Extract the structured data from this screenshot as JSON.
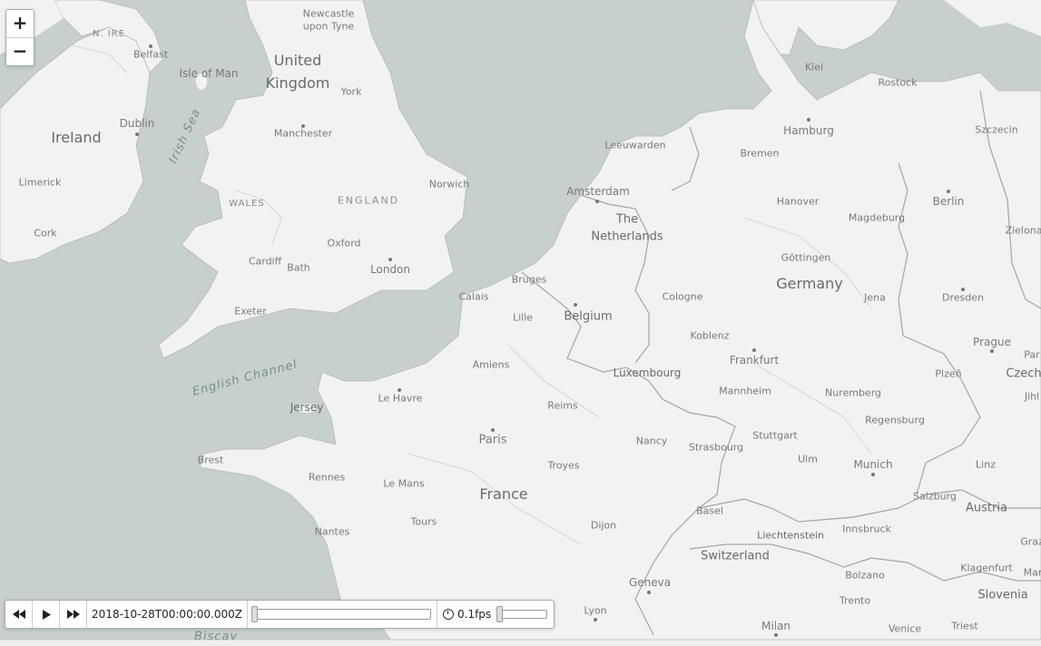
{
  "map": {
    "colors": {
      "water": "#c7cfcf",
      "land": "#f2f2f2",
      "border": "#a9a9a9"
    },
    "labels": {
      "countries": [
        "United",
        "Kingdom",
        "Ireland",
        "France",
        "Germany",
        "Belgium",
        "The",
        "Netherlands",
        "Luxembourg",
        "Switzerland",
        "Liechtenstein",
        "Austria",
        "Slovenia",
        "Czech",
        "Jersey"
      ],
      "regions": [
        "N. IRE",
        "ENGLAND",
        "WALES"
      ],
      "water": [
        "Irish Sea",
        "English Channel",
        "Biscay"
      ],
      "cities": [
        "Newcastle",
        "upon Tyne",
        "Belfast",
        "Isle of Man",
        "York",
        "Dublin",
        "Manchester",
        "Limerick",
        "Cork",
        "Norwich",
        "Oxford",
        "London",
        "Cardiff",
        "Bath",
        "Exeter",
        "Calais",
        "Bruges",
        "Lille",
        "Amiens",
        "Le Havre",
        "Brest",
        "Rennes",
        "Le Mans",
        "Nantes",
        "Tours",
        "Paris",
        "Reims",
        "Troyes",
        "Nancy",
        "Strasbourg",
        "Dijon",
        "Basel",
        "Geneva",
        "Lyon",
        "Leeuwarden",
        "Amsterdam",
        "Cologne",
        "Koblenz",
        "Frankfurt",
        "Mannheim",
        "Stuttgart",
        "Ulm",
        "Munich",
        "Nuremberg",
        "Regensburg",
        "Hamburg",
        "Bremen",
        "Hanover",
        "Göttingen",
        "Magdeburg",
        "Berlin",
        "Jena",
        "Dresden",
        "Kiel",
        "Rostock",
        "Szczecin",
        "Zielona",
        "Prague",
        "Plzeň",
        "Jihl",
        "Par",
        "Linz",
        "Salzburg",
        "Innsbruck",
        "Bolzano",
        "Trento",
        "Klagenfurt",
        "Graz",
        "Mar",
        "Venice",
        "Triest",
        "Milan"
      ]
    }
  },
  "zoom": {
    "in_label": "+",
    "out_label": "−"
  },
  "time_control": {
    "back_icon": "fast-backward-icon",
    "play_icon": "play-icon",
    "forward_icon": "fast-forward-icon",
    "current_time": "2018-10-28T00:00:00.000Z",
    "progress": 0,
    "speed_label": "0.1fps",
    "speed_level": 0
  }
}
